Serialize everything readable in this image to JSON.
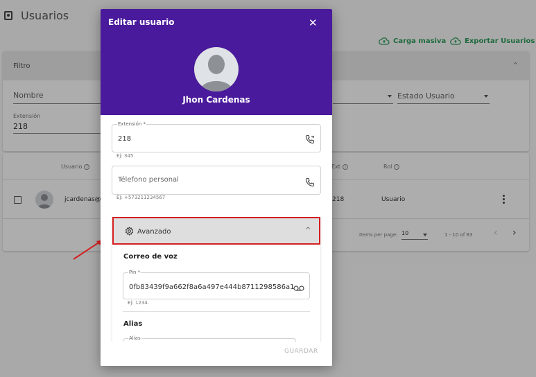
{
  "page": {
    "title": "Usuarios",
    "actions": [
      {
        "label": "Carga masiva"
      },
      {
        "label": "Exportar Usuarios"
      }
    ]
  },
  "filter": {
    "title": "Filtro",
    "fields": {
      "nombre_label": "Nombre",
      "estado_label": "Estado Usuario",
      "extension_label": "Extensión",
      "extension_value": "218"
    }
  },
  "table": {
    "headers": {
      "usuario": "Usuario",
      "ext": "Ext",
      "rol": "Rol"
    },
    "rows": [
      {
        "email": "jcardenas@",
        "ext": "218",
        "rol": "Usuario"
      }
    ],
    "pagination": {
      "items_per_page_label": "Items per page:",
      "items_per_page_value": "10",
      "range": "1 - 10 of 83",
      "prev_icon": "chevron-left-icon",
      "next_icon": "chevron-right-icon"
    }
  },
  "dialog": {
    "title": "Editar usuario",
    "user_name": "Jhon Cardenas",
    "extension": {
      "label": "Extensión *",
      "value": "218",
      "hint": "Ej: 345."
    },
    "telefono": {
      "placeholder": "Télefono personal",
      "hint": "Ej: +573211234567"
    },
    "advanced": {
      "label": "Avanzado"
    },
    "voicemail": {
      "title": "Correo de voz",
      "pin_label": "Pin *",
      "pin_value": "0fb83439f9a662f8a6a497e444b8711298586a1",
      "pin_hint": "Ej: 1234."
    },
    "alias": {
      "title": "Alias",
      "field_label": "Alias"
    },
    "save_label": "GUARDAR"
  },
  "colors": {
    "header_purple": "#4a1a9c",
    "highlight_red": "#d61f1f",
    "action_green": "#2e9e5b"
  }
}
